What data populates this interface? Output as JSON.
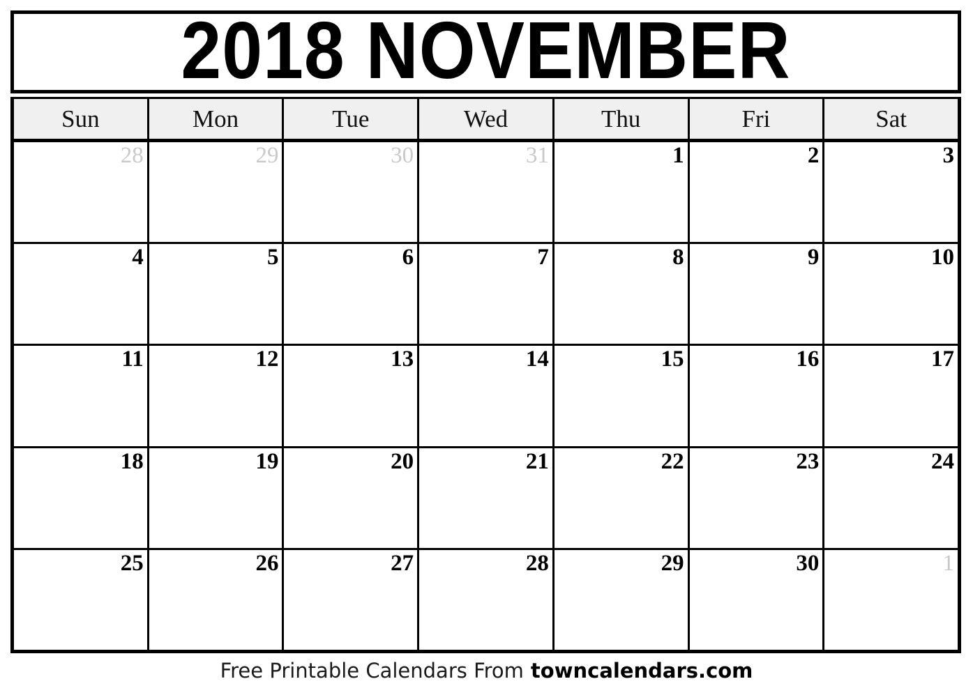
{
  "document": {
    "title": "2018 NOVEMBER",
    "year": "2018",
    "month": "NOVEMBER"
  },
  "calendar": {
    "weekday_headers": [
      "Sun",
      "Mon",
      "Tue",
      "Wed",
      "Thu",
      "Fri",
      "Sat"
    ],
    "weeks": [
      [
        {
          "label": "28",
          "in_month": false
        },
        {
          "label": "29",
          "in_month": false
        },
        {
          "label": "30",
          "in_month": false
        },
        {
          "label": "31",
          "in_month": false
        },
        {
          "label": "1",
          "in_month": true
        },
        {
          "label": "2",
          "in_month": true
        },
        {
          "label": "3",
          "in_month": true
        }
      ],
      [
        {
          "label": "4",
          "in_month": true
        },
        {
          "label": "5",
          "in_month": true
        },
        {
          "label": "6",
          "in_month": true
        },
        {
          "label": "7",
          "in_month": true
        },
        {
          "label": "8",
          "in_month": true
        },
        {
          "label": "9",
          "in_month": true
        },
        {
          "label": "10",
          "in_month": true
        }
      ],
      [
        {
          "label": "11",
          "in_month": true
        },
        {
          "label": "12",
          "in_month": true
        },
        {
          "label": "13",
          "in_month": true
        },
        {
          "label": "14",
          "in_month": true
        },
        {
          "label": "15",
          "in_month": true
        },
        {
          "label": "16",
          "in_month": true
        },
        {
          "label": "17",
          "in_month": true
        }
      ],
      [
        {
          "label": "18",
          "in_month": true
        },
        {
          "label": "19",
          "in_month": true
        },
        {
          "label": "20",
          "in_month": true
        },
        {
          "label": "21",
          "in_month": true
        },
        {
          "label": "22",
          "in_month": true
        },
        {
          "label": "23",
          "in_month": true
        },
        {
          "label": "24",
          "in_month": true
        }
      ],
      [
        {
          "label": "25",
          "in_month": true
        },
        {
          "label": "26",
          "in_month": true
        },
        {
          "label": "27",
          "in_month": true
        },
        {
          "label": "28",
          "in_month": true
        },
        {
          "label": "29",
          "in_month": true
        },
        {
          "label": "30",
          "in_month": true
        },
        {
          "label": "1",
          "in_month": false
        }
      ]
    ]
  },
  "footer": {
    "text": "Free Printable Calendars From",
    "brand": "towncalendars.com"
  },
  "colors": {
    "border": "#000000",
    "header_background": "#f0f0f0",
    "in_month_text": "#000000",
    "out_of_month_text": "#c9c9c9",
    "page_background": "#ffffff"
  }
}
